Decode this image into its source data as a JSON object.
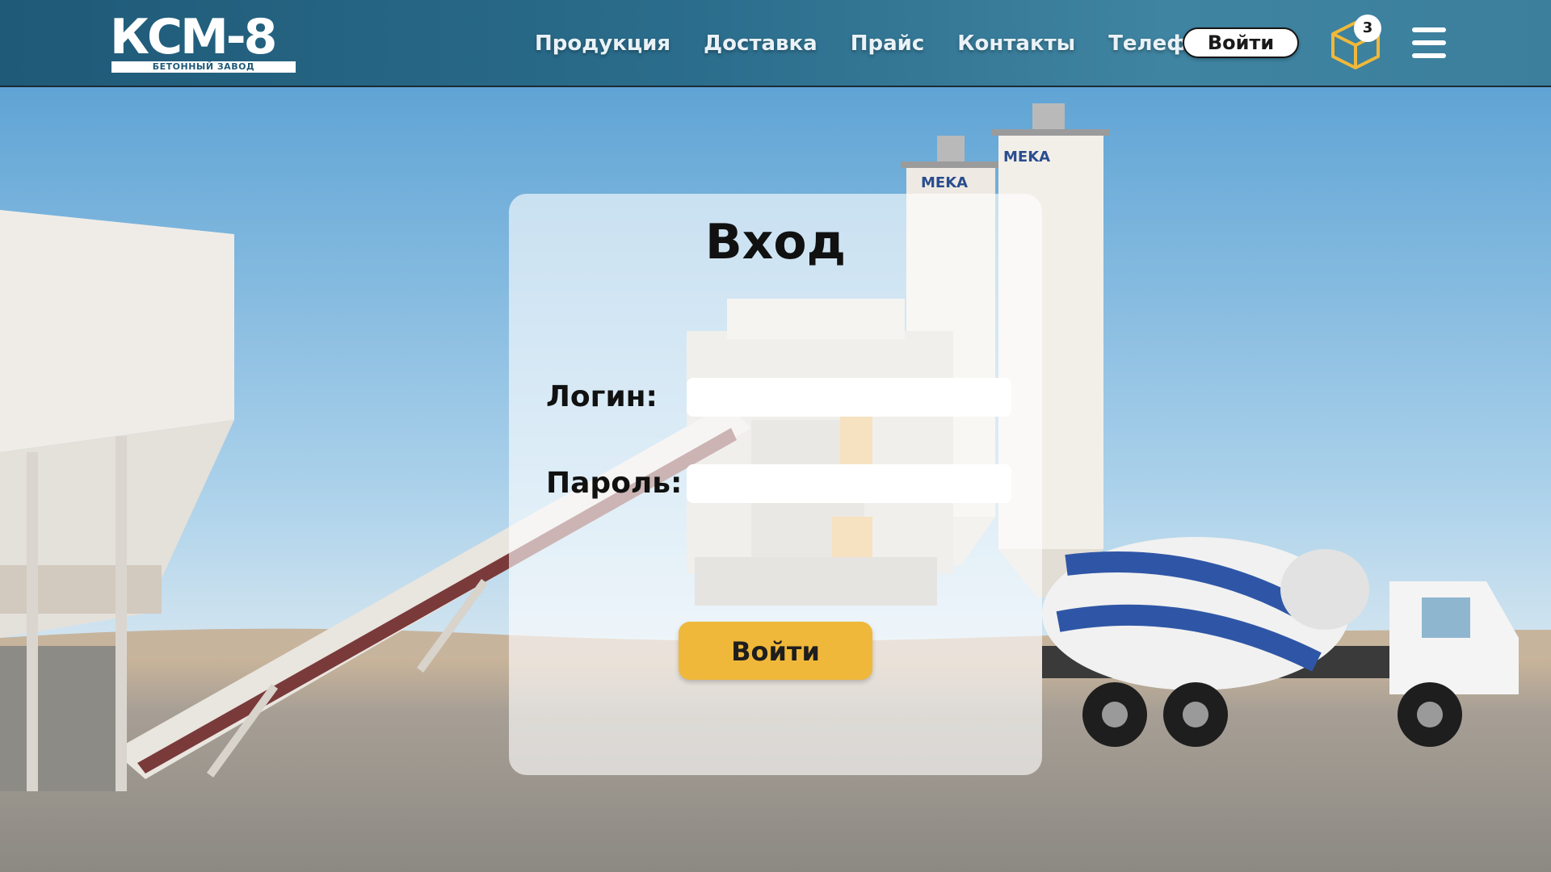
{
  "brand": {
    "logo_text": "КСМ-8",
    "logo_subtitle": "БЕТОННЫЙ ЗАВОД"
  },
  "nav": {
    "items": [
      {
        "label": "Продукция"
      },
      {
        "label": "Доставка"
      },
      {
        "label": "Прайс"
      },
      {
        "label": "Контакты"
      },
      {
        "label": "Телефон"
      }
    ],
    "login_label": "Войти",
    "cart_count": "3"
  },
  "login_form": {
    "title": "Вход",
    "login_label": "Логин:",
    "login_value": "",
    "password_label": "Пароль:",
    "password_value": "",
    "submit_label": "Войти"
  },
  "background": {
    "silo_brand": "MEKA"
  },
  "colors": {
    "header": "#2b6d8c",
    "accent_button": "#f0b83a",
    "cart_icon": "#f0b83a"
  },
  "icons": {
    "cart": "box-icon",
    "menu": "hamburger-icon"
  }
}
